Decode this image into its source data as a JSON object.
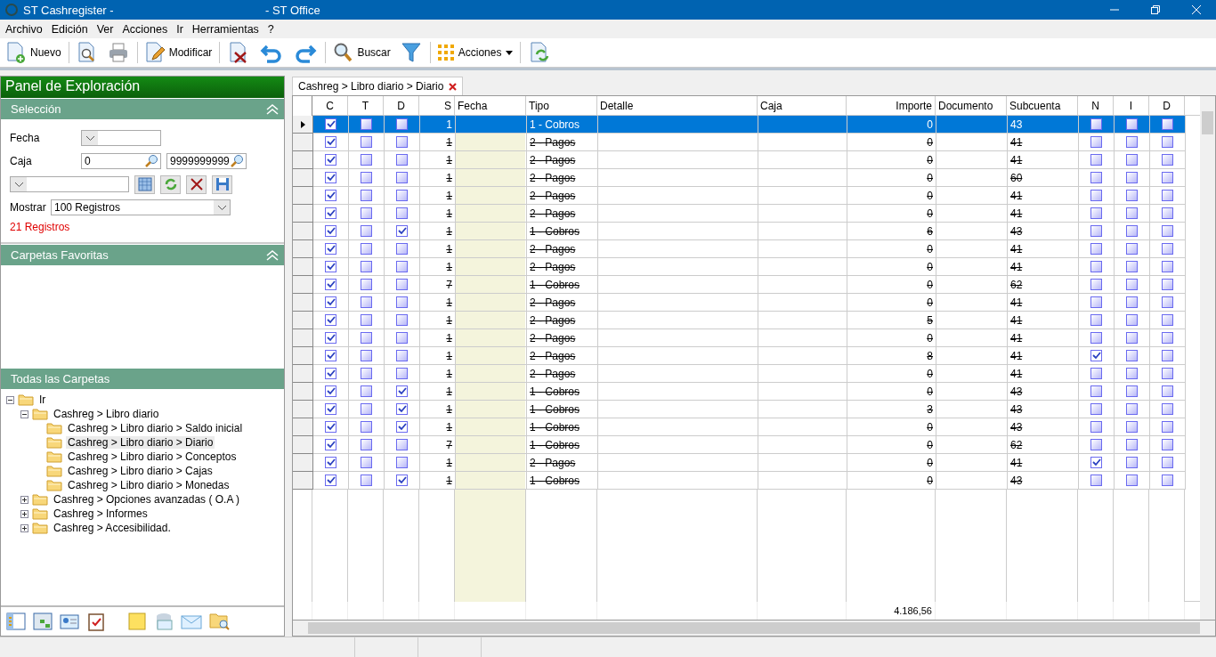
{
  "window": {
    "title_left": "ST Cashregister -",
    "title_right": "- ST Office"
  },
  "menu": [
    "Archivo",
    "Edición",
    "Ver",
    "Acciones",
    "Ir",
    "Herramientas",
    "?"
  ],
  "toolbar": {
    "new": "Nuevo",
    "edit": "Modificar",
    "search": "Buscar",
    "actions": "Acciones"
  },
  "panel": {
    "title": "Panel de Exploración",
    "selection": {
      "title": "Selección",
      "fecha_label": "Fecha",
      "caja_label": "Caja",
      "caja_from": "0",
      "caja_to": "9999999999",
      "mostrar_label": "Mostrar",
      "mostrar_value": "100  Registros",
      "count": "21 Registros"
    },
    "favorites": {
      "title": "Carpetas Favoritas"
    },
    "all": {
      "title": "Todas las Carpetas",
      "tree": [
        {
          "label": "Ir",
          "expanded": true,
          "selected": false,
          "children": [
            {
              "label": "Cashreg > Libro diario",
              "expanded": true,
              "selected": false,
              "children": [
                {
                  "label": "Cashreg > Libro diario > Saldo inicial",
                  "selected": false
                },
                {
                  "label": "Cashreg > Libro diario > Diario",
                  "selected": true
                },
                {
                  "label": "Cashreg > Libro diario > Conceptos",
                  "selected": false
                },
                {
                  "label": "Cashreg > Libro diario > Cajas",
                  "selected": false
                },
                {
                  "label": "Cashreg > Libro diario > Monedas",
                  "selected": false
                }
              ]
            },
            {
              "label": "Cashreg > Opciones avanzadas ( O.A )",
              "expanded": false,
              "selected": false
            },
            {
              "label": "Cashreg > Informes",
              "expanded": false,
              "selected": false
            },
            {
              "label": "Cashreg > Accesibilidad.",
              "expanded": false,
              "selected": false
            }
          ]
        }
      ]
    }
  },
  "tab": {
    "label": "Cashreg > Libro diario > Diario"
  },
  "table": {
    "columns": [
      "C",
      "T",
      "D",
      "S",
      "Fecha",
      "Tipo",
      "Detalle",
      "Caja",
      "Importe",
      "Documento",
      "Subcuenta",
      "N",
      "I",
      "D"
    ],
    "rows": [
      {
        "selected": true,
        "struck": false,
        "c": true,
        "t": false,
        "d": false,
        "s": "1",
        "tipo": "1 - Cobros",
        "importe": "0",
        "subcuenta": "43",
        "n": false,
        "i": false,
        "d2": false
      },
      {
        "selected": false,
        "struck": true,
        "c": true,
        "t": false,
        "d": false,
        "s": "1",
        "tipo": "2 - Pagos",
        "importe": "0",
        "subcuenta": "41",
        "n": false,
        "i": false,
        "d2": false
      },
      {
        "selected": false,
        "struck": true,
        "c": true,
        "t": false,
        "d": false,
        "s": "1",
        "tipo": "2 - Pagos",
        "importe": "0",
        "subcuenta": "41",
        "n": false,
        "i": false,
        "d2": false
      },
      {
        "selected": false,
        "struck": true,
        "c": true,
        "t": false,
        "d": false,
        "s": "1",
        "tipo": "2 - Pagos",
        "importe": "0",
        "subcuenta": "60",
        "n": false,
        "i": false,
        "d2": false
      },
      {
        "selected": false,
        "struck": true,
        "c": true,
        "t": false,
        "d": false,
        "s": "1",
        "tipo": "2 - Pagos",
        "importe": "0",
        "subcuenta": "41",
        "n": false,
        "i": false,
        "d2": false
      },
      {
        "selected": false,
        "struck": true,
        "c": true,
        "t": false,
        "d": false,
        "s": "1",
        "tipo": "2 - Pagos",
        "importe": "0",
        "subcuenta": "41",
        "n": false,
        "i": false,
        "d2": false
      },
      {
        "selected": false,
        "struck": true,
        "c": true,
        "t": false,
        "d": true,
        "s": "1",
        "tipo": "1 - Cobros",
        "importe": "6",
        "subcuenta": "43",
        "n": false,
        "i": false,
        "d2": false
      },
      {
        "selected": false,
        "struck": true,
        "c": true,
        "t": false,
        "d": false,
        "s": "1",
        "tipo": "2 - Pagos",
        "importe": "0",
        "subcuenta": "41",
        "n": false,
        "i": false,
        "d2": false
      },
      {
        "selected": false,
        "struck": true,
        "c": true,
        "t": false,
        "d": false,
        "s": "1",
        "tipo": "2 - Pagos",
        "importe": "0",
        "subcuenta": "41",
        "n": false,
        "i": false,
        "d2": false
      },
      {
        "selected": false,
        "struck": true,
        "c": true,
        "t": false,
        "d": false,
        "s": "7",
        "tipo": "1 - Cobros",
        "importe": "0",
        "subcuenta": "62",
        "n": false,
        "i": false,
        "d2": false
      },
      {
        "selected": false,
        "struck": true,
        "c": true,
        "t": false,
        "d": false,
        "s": "1",
        "tipo": "2 - Pagos",
        "importe": "0",
        "subcuenta": "41",
        "n": false,
        "i": false,
        "d2": false
      },
      {
        "selected": false,
        "struck": true,
        "c": true,
        "t": false,
        "d": false,
        "s": "1",
        "tipo": "2 - Pagos",
        "importe": "5",
        "subcuenta": "41",
        "n": false,
        "i": false,
        "d2": false
      },
      {
        "selected": false,
        "struck": true,
        "c": true,
        "t": false,
        "d": false,
        "s": "1",
        "tipo": "2 - Pagos",
        "importe": "0",
        "subcuenta": "41",
        "n": false,
        "i": false,
        "d2": false
      },
      {
        "selected": false,
        "struck": true,
        "c": true,
        "t": false,
        "d": false,
        "s": "1",
        "tipo": "2 - Pagos",
        "importe": "8",
        "subcuenta": "41",
        "n": true,
        "i": false,
        "d2": false
      },
      {
        "selected": false,
        "struck": true,
        "c": true,
        "t": false,
        "d": false,
        "s": "1",
        "tipo": "2 - Pagos",
        "importe": "0",
        "subcuenta": "41",
        "n": false,
        "i": false,
        "d2": false
      },
      {
        "selected": false,
        "struck": true,
        "c": true,
        "t": false,
        "d": true,
        "s": "1",
        "tipo": "1 - Cobros",
        "importe": "0",
        "subcuenta": "43",
        "n": false,
        "i": false,
        "d2": false
      },
      {
        "selected": false,
        "struck": true,
        "c": true,
        "t": false,
        "d": true,
        "s": "1",
        "tipo": "1 - Cobros",
        "importe": "3",
        "subcuenta": "43",
        "n": false,
        "i": false,
        "d2": false
      },
      {
        "selected": false,
        "struck": true,
        "c": true,
        "t": false,
        "d": true,
        "s": "1",
        "tipo": "1 - Cobros",
        "importe": "0",
        "subcuenta": "43",
        "n": false,
        "i": false,
        "d2": false
      },
      {
        "selected": false,
        "struck": true,
        "c": true,
        "t": false,
        "d": false,
        "s": "7",
        "tipo": "1 - Cobros",
        "importe": "0",
        "subcuenta": "62",
        "n": false,
        "i": false,
        "d2": false
      },
      {
        "selected": false,
        "struck": true,
        "c": true,
        "t": false,
        "d": false,
        "s": "1",
        "tipo": "2 - Pagos",
        "importe": "0",
        "subcuenta": "41",
        "n": true,
        "i": false,
        "d2": false
      },
      {
        "selected": false,
        "struck": true,
        "c": true,
        "t": false,
        "d": true,
        "s": "1",
        "tipo": "1 - Cobros",
        "importe": "0",
        "subcuenta": "43",
        "n": false,
        "i": false,
        "d2": false
      }
    ],
    "total": "4.186,56"
  }
}
